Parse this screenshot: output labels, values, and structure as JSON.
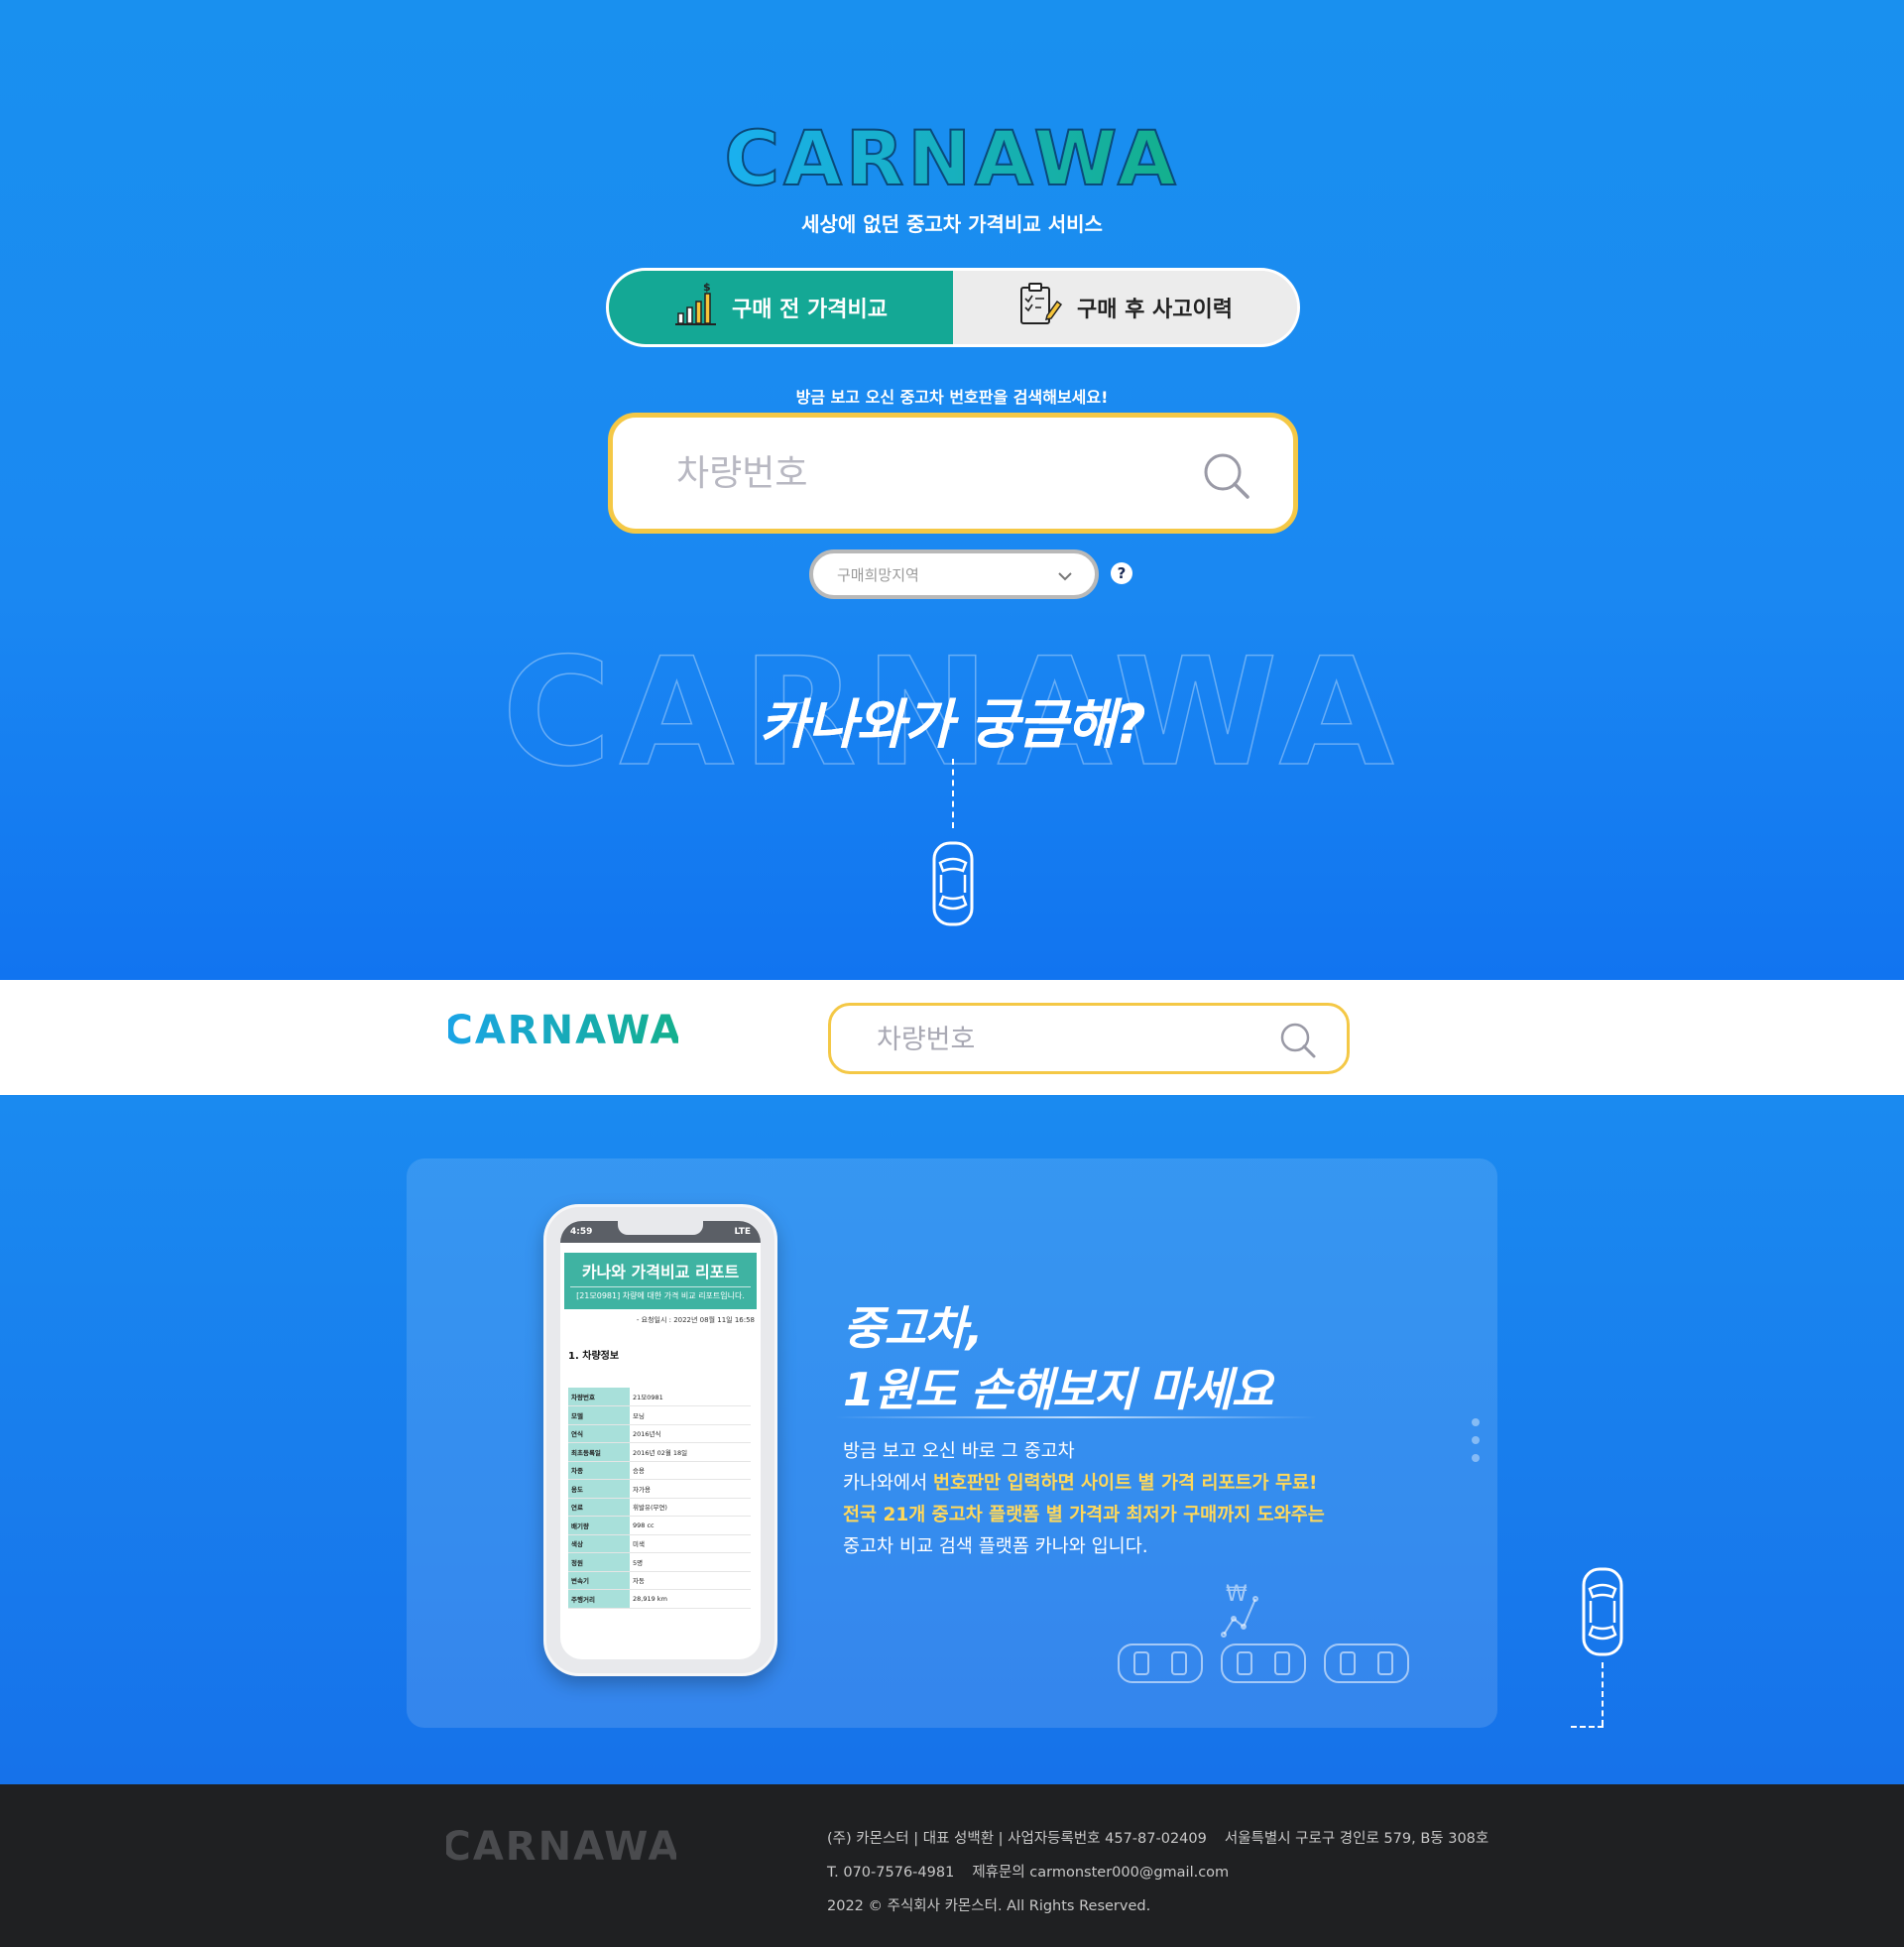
{
  "brand": {
    "name": "CARNAWA",
    "tagline": "세상에 없던 중고차 가격비교 서비스",
    "colors": {
      "primary_blue": "#1a8af0",
      "teal": "#14a895",
      "yellow": "#f4c846",
      "dark": "#1f2022"
    }
  },
  "tabs": [
    {
      "label": "구매 전 가격비교",
      "icon": "price-chart-icon",
      "active": true
    },
    {
      "label": "구매 후 사고이력",
      "icon": "clipboard-edit-icon",
      "active": false
    }
  ],
  "search": {
    "hint": "방금 보고 오신 중고차 번호판을 검색해보세요!",
    "placeholder": "차량번호",
    "region_placeholder": "구매희망지역",
    "help": "?"
  },
  "curious": {
    "heading": "카나와가 궁금해?"
  },
  "sticky_bar": {
    "search_placeholder": "차량번호"
  },
  "phone": {
    "time": "4:59",
    "network": "LTE",
    "report_title": "카나와 가격비교 리포트",
    "report_subtitle": "[21모0981] 차량에 대한 가격 비교 리포트입니다.",
    "request_time": "- 요청일시 : 2022년 08월 11일 16:58",
    "section": "1. 차량정보",
    "specs": [
      {
        "k": "차량번호",
        "v": "21모0981"
      },
      {
        "k": "모델",
        "v": "모닝"
      },
      {
        "k": "연식",
        "v": "2016년식"
      },
      {
        "k": "최초등록일",
        "v": "2016년 02월 18일"
      },
      {
        "k": "차종",
        "v": "승용"
      },
      {
        "k": "용도",
        "v": "자가용"
      },
      {
        "k": "연료",
        "v": "휘발유(무연)"
      },
      {
        "k": "배기량",
        "v": "998 cc"
      },
      {
        "k": "색상",
        "v": "미색"
      },
      {
        "k": "정원",
        "v": "5명"
      },
      {
        "k": "변속기",
        "v": "자동"
      },
      {
        "k": "주행거리",
        "v": "28,919 km"
      }
    ]
  },
  "feature": {
    "title_line1": "중고차,",
    "title_line2": "1원도 손해보지 마세요",
    "desc_line1": "방금 보고 오신 바로 그 중고차",
    "desc_line2_pre": "카나와에서 ",
    "desc_line2_hl": "번호판만 입력하면 사이트 별 가격 리포트가 무료!",
    "desc_line3_hl": "전국 21개 중고차 플랫폼 별 가격과 최저가 구매까지 도와주는",
    "desc_line4": "중고차 비교 검색 플랫폼 카나와 입니다."
  },
  "footer": {
    "line1_company": "(주) 카몬스터 | 대표 성백환 | 사업자등록번호 457-87-02409",
    "line1_address": "서울특별시 구로구 경인로 579, B동 308호",
    "line2_tel": "T. 070-7576-4981",
    "line2_email": "제휴문의 carmonster000@gmail.com",
    "line3": "2022 © 주식회사 카몬스터. All Rights Reserved."
  }
}
